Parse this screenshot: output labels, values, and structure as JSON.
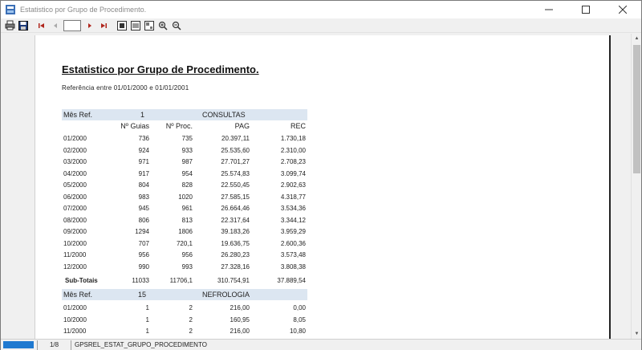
{
  "window": {
    "title": "Estatistico por Grupo de Procedimento."
  },
  "toolbar": {
    "page_value": ""
  },
  "report": {
    "title": "Estatistico por Grupo de Procedimento.",
    "reference": "Referência entre 01/01/2000 e 01/01/2001",
    "columns": {
      "guias": "Nº Guias",
      "proc": "Nº Proc.",
      "pag": "PAG",
      "rec": "REC"
    },
    "groups": [
      {
        "label": "Mês Ref.",
        "code": "1",
        "name": "CONSULTAS",
        "rows": [
          {
            "mes": "01/2000",
            "guias": "736",
            "proc": "735",
            "pag": "20.397,11",
            "rec": "1.730,18"
          },
          {
            "mes": "02/2000",
            "guias": "924",
            "proc": "933",
            "pag": "25.535,60",
            "rec": "2.310,00"
          },
          {
            "mes": "03/2000",
            "guias": "971",
            "proc": "987",
            "pag": "27.701,27",
            "rec": "2.708,23"
          },
          {
            "mes": "04/2000",
            "guias": "917",
            "proc": "954",
            "pag": "25.574,83",
            "rec": "3.099,74"
          },
          {
            "mes": "05/2000",
            "guias": "804",
            "proc": "828",
            "pag": "22.550,45",
            "rec": "2.902,63"
          },
          {
            "mes": "06/2000",
            "guias": "983",
            "proc": "1020",
            "pag": "27.585,15",
            "rec": "4.318,77"
          },
          {
            "mes": "07/2000",
            "guias": "945",
            "proc": "961",
            "pag": "26.664,46",
            "rec": "3.534,36"
          },
          {
            "mes": "08/2000",
            "guias": "806",
            "proc": "813",
            "pag": "22.317,64",
            "rec": "3.344,12"
          },
          {
            "mes": "09/2000",
            "guias": "1294",
            "proc": "1806",
            "pag": "39.183,26",
            "rec": "3.959,29"
          },
          {
            "mes": "10/2000",
            "guias": "707",
            "proc": "720,1",
            "pag": "19.636,75",
            "rec": "2.600,36"
          },
          {
            "mes": "11/2000",
            "guias": "956",
            "proc": "956",
            "pag": "26.280,23",
            "rec": "3.573,48"
          },
          {
            "mes": "12/2000",
            "guias": "990",
            "proc": "993",
            "pag": "27.328,16",
            "rec": "3.808,38"
          }
        ],
        "subtotal": {
          "label": "Sub-Totais",
          "guias": "11033",
          "proc": "11706,1",
          "pag": "310.754,91",
          "rec": "37.889,54"
        }
      },
      {
        "label": "Mês Ref.",
        "code": "15",
        "name": "NEFROLOGIA",
        "rows": [
          {
            "mes": "01/2000",
            "guias": "1",
            "proc": "2",
            "pag": "216,00",
            "rec": "0,00"
          },
          {
            "mes": "10/2000",
            "guias": "1",
            "proc": "2",
            "pag": "160,95",
            "rec": "8,05"
          },
          {
            "mes": "11/2000",
            "guias": "1",
            "proc": "2",
            "pag": "216,00",
            "rec": "10,80"
          }
        ]
      }
    ]
  },
  "status": {
    "page": "1/8",
    "report_name": "GPSREL_ESTAT_GRUPO_PROCEDIMENTO"
  }
}
